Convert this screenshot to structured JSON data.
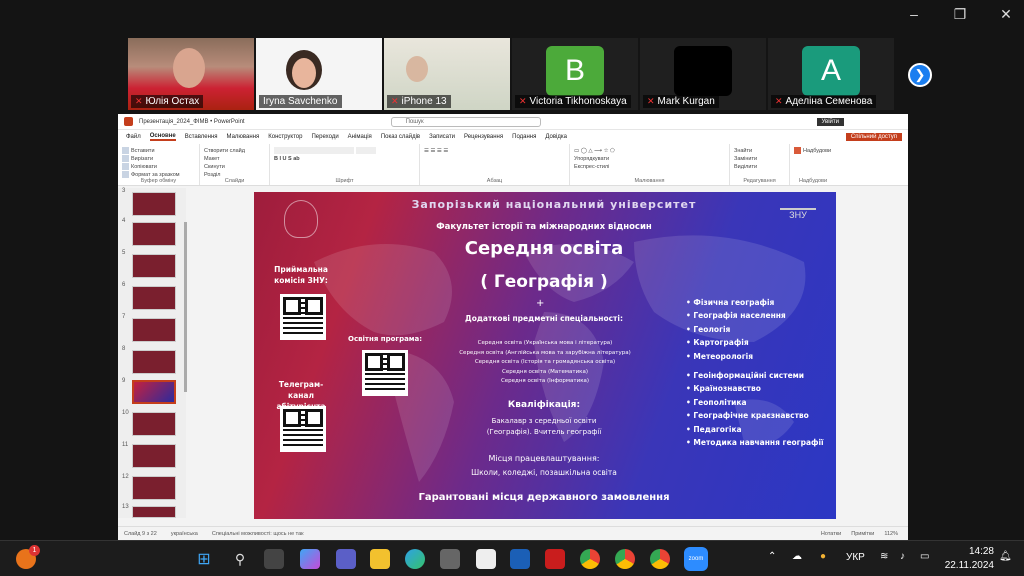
{
  "zoom": {
    "window_controls": [
      "–",
      "❐",
      "✕"
    ],
    "participants": [
      {
        "name": "Юлія Остах",
        "muted": true
      },
      {
        "name": "Iryna Savchenko",
        "muted": false,
        "active": true
      },
      {
        "name": "iPhone 13",
        "muted": true
      },
      {
        "name": "Victoria Tikhonoskaya",
        "muted": true,
        "initial": "B",
        "color": "#4caa3a"
      },
      {
        "name": "Mark Kurgan",
        "muted": true,
        "initial": "",
        "color": "#000000"
      },
      {
        "name": "Аделіна Семенова",
        "muted": true,
        "initial": "A",
        "color": "#1a9b7c"
      }
    ],
    "next_icon": "chevron-right-icon"
  },
  "ppt": {
    "file_title": "Презентація_2024_ФІМВ • PowerPoint",
    "search_placeholder": "Пошук",
    "signin": "Увійти",
    "tabs": [
      "Файл",
      "Основне",
      "Вставлення",
      "Малювання",
      "Конструктор",
      "Переходи",
      "Анімація",
      "Показ слайдів",
      "Записати",
      "Рецензування",
      "Подання",
      "Довідка"
    ],
    "share_label": "Спільний доступ",
    "ribbon": {
      "clipboard": {
        "paste": "Вставити",
        "cut": "Вирізати",
        "copy": "Копіювати",
        "format": "Формат за зразком",
        "label": "Буфер обміну"
      },
      "slides": {
        "new": "Створити слайд",
        "layout": "Макет",
        "reset": "Скинути",
        "section": "Розділ",
        "label": "Слайди"
      },
      "font": {
        "label": "Шрифт"
      },
      "paragraph": {
        "label": "Абзац"
      },
      "drawing": {
        "arrange": "Упорядкувати",
        "styles": "Експрес-стилі",
        "label": "Малювання"
      },
      "editing": {
        "find": "Знайти",
        "replace": "Замінити",
        "select": "Виділити",
        "label": "Редагування"
      },
      "designer": {
        "label": "Надбудови",
        "btn": "Надбудови"
      }
    },
    "thumb_numbers": [
      "3",
      "4",
      "5",
      "6",
      "7",
      "8",
      "9",
      "10",
      "11",
      "12",
      "13"
    ],
    "status": {
      "slide": "Слайд 9 з 22",
      "lang": "українська",
      "accessibility": "Спеціальні можливості: щось не так",
      "notes": "Нотатки",
      "comments": "Примітки",
      "zoom": "112%"
    }
  },
  "slide": {
    "university": "Запорізький національний університет",
    "faculty": "Факультет історії та міжнародних відносин",
    "title": "Середня освіта",
    "subtitle": "( Географія )",
    "plus": "+",
    "additional_label": "Додаткові предметні спеціальності:",
    "specialties": [
      "Середня освіта (Українська мова і література)",
      "Середня освіта (Англійська мова та зарубіжна література)",
      "Середня освіта (Історія та громадянська освіта)",
      "Середня освіта (Математика)",
      "Середня освіта (Інформатика)"
    ],
    "admission": "Приймальна комісія ЗНУ:",
    "program": "Освітня програма:",
    "telegram": "Телеграм-канал абітурієнта ФІМВ:",
    "qualification_label": "Кваліфікація:",
    "qualification": "Бакалавр з середньої освіти (Географія). Вчитель географії",
    "workplace_label": "Місця працевлаштування:",
    "workplace": "Школи, коледжі, позашкільна освіта",
    "guarantee": "Гарантовані місця державного замовлення",
    "znu_logo": "ЗНУ",
    "subjects_a": [
      "Фізична географія",
      "Географія населення",
      "Геологія",
      "Картографія",
      "Метеорологія"
    ],
    "subjects_b": [
      "Геоінформаційні системи",
      "Країнознавство",
      "Геополітика",
      "Географічне краєзнавство",
      "Педагогіка",
      "Методика навчання географії"
    ]
  },
  "taskbar": {
    "badge_count": "1",
    "lang": "УКР",
    "time": "14:28",
    "date": "22.11.2024",
    "zoom_app": "zoom"
  }
}
